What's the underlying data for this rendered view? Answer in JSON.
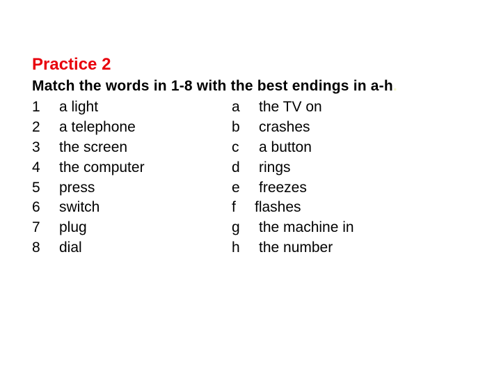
{
  "title": "Practice 2",
  "instruction": "Match the words in 1-8 with the best endings in a-h",
  "instruction_end": ".",
  "colors": {
    "title": "#e8000b",
    "text": "#000000",
    "background": "#ffffff"
  },
  "rows": [
    {
      "number": "1",
      "word": "a light",
      "letter": "a",
      "ending": "the TV on"
    },
    {
      "number": "2",
      "word": "a telephone",
      "letter": "b",
      "ending": "crashes"
    },
    {
      "number": "3",
      "word": "the screen",
      "letter": "c",
      "ending": "a button"
    },
    {
      "number": "4",
      "word": "the computer",
      "letter": "d",
      "ending": "rings"
    },
    {
      "number": "5",
      "word": "press",
      "letter": "e",
      "ending": "freezes"
    },
    {
      "number": "6",
      "word": "switch",
      "letter": "f",
      "ending": "flashes"
    },
    {
      "number": "7",
      "word": "plug",
      "letter": "g",
      "ending": "the machine in"
    },
    {
      "number": "8",
      "word": "dial",
      "letter": "h",
      "ending": "the number"
    }
  ]
}
